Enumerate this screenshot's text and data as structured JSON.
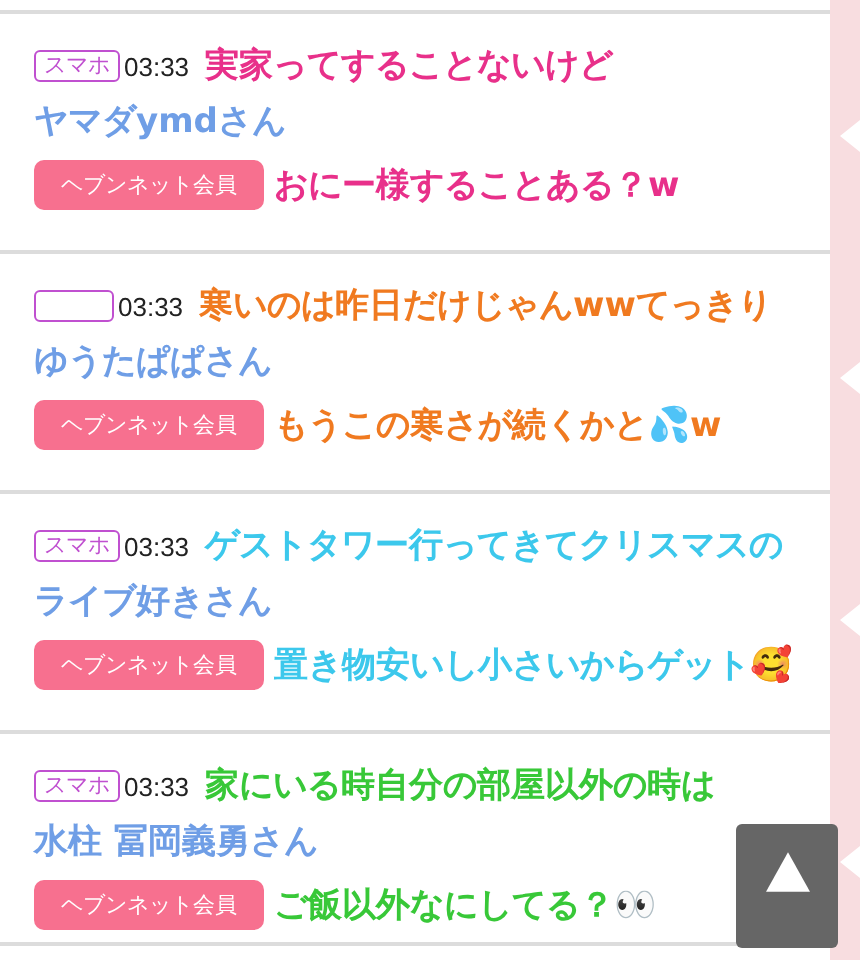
{
  "posts": [
    {
      "badge": "スマホ",
      "time": "03:33",
      "name": "ヤマダymdさん",
      "member": "ヘブンネット会員"
    },
    {
      "time": "03:33",
      "name": "ゆうたぱぱさん",
      "member": "ヘブンネット会員"
    },
    {
      "badge": "スマホ",
      "time": "03:33",
      "name": "ライブ好きさん",
      "member": "ヘブンネット会員"
    },
    {
      "badge": "スマホ",
      "time": "03:33",
      "name": "水柱 冨岡義勇さん",
      "member": "ヘブンネット会員"
    }
  ],
  "comments": [
    {
      "color": "#e8308a",
      "lines": [
        "実家ってすることないけど",
        "おにー様することある？w"
      ]
    },
    {
      "color": "#f07a20",
      "lines": [
        "寒いのは昨日だけじゃんwwてっきり",
        "もうこの寒さが続くかと💦w"
      ]
    },
    {
      "color": "#3cc8ec",
      "lines": [
        "ゲストタワー行ってきてクリスマスの",
        "置き物安いし小さいからゲット🥰"
      ]
    },
    {
      "color": "#38c838",
      "lines": [
        "家にいる時自分の部屋以外の時は",
        "ご飯以外なにしてる？👀"
      ]
    }
  ]
}
